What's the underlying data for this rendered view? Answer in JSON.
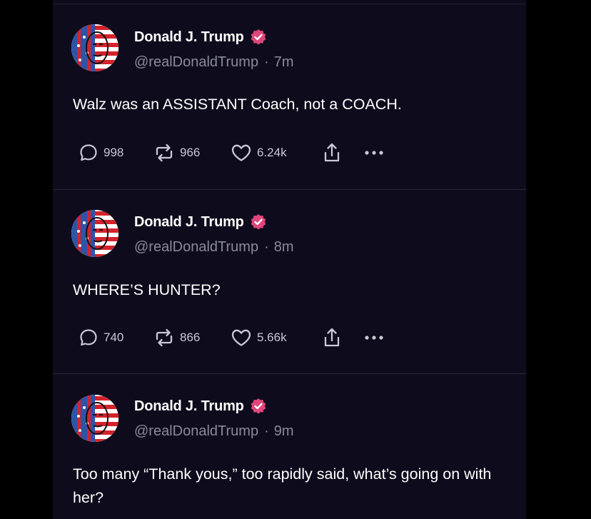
{
  "colors": {
    "background": "#0e0c1c",
    "text": "#ffffff",
    "secondary_text": "#8b8a9a",
    "verified_badge": "#e0467a",
    "divider": "#2a2838"
  },
  "posts": [
    {
      "display_name": "Donald J. Trump",
      "handle": "@realDonaldTrump",
      "separator": "·",
      "time": "7m",
      "text": "Walz was an ASSISTANT Coach, not a COACH.",
      "replies": "998",
      "reposts": "966",
      "likes": "6.24k",
      "icons": [
        "reply-icon",
        "repost-icon",
        "like-icon",
        "share-icon",
        "more-icon"
      ]
    },
    {
      "display_name": "Donald J. Trump",
      "handle": "@realDonaldTrump",
      "separator": "·",
      "time": "8m",
      "text": "WHERE’S HUNTER?",
      "replies": "740",
      "reposts": "866",
      "likes": "5.66k",
      "icons": [
        "reply-icon",
        "repost-icon",
        "like-icon",
        "share-icon",
        "more-icon"
      ]
    },
    {
      "display_name": "Donald J. Trump",
      "handle": "@realDonaldTrump",
      "separator": "·",
      "time": "9m",
      "text": "Too many “Thank yous,” too rapidly said, what’s going on with her?"
    }
  ]
}
